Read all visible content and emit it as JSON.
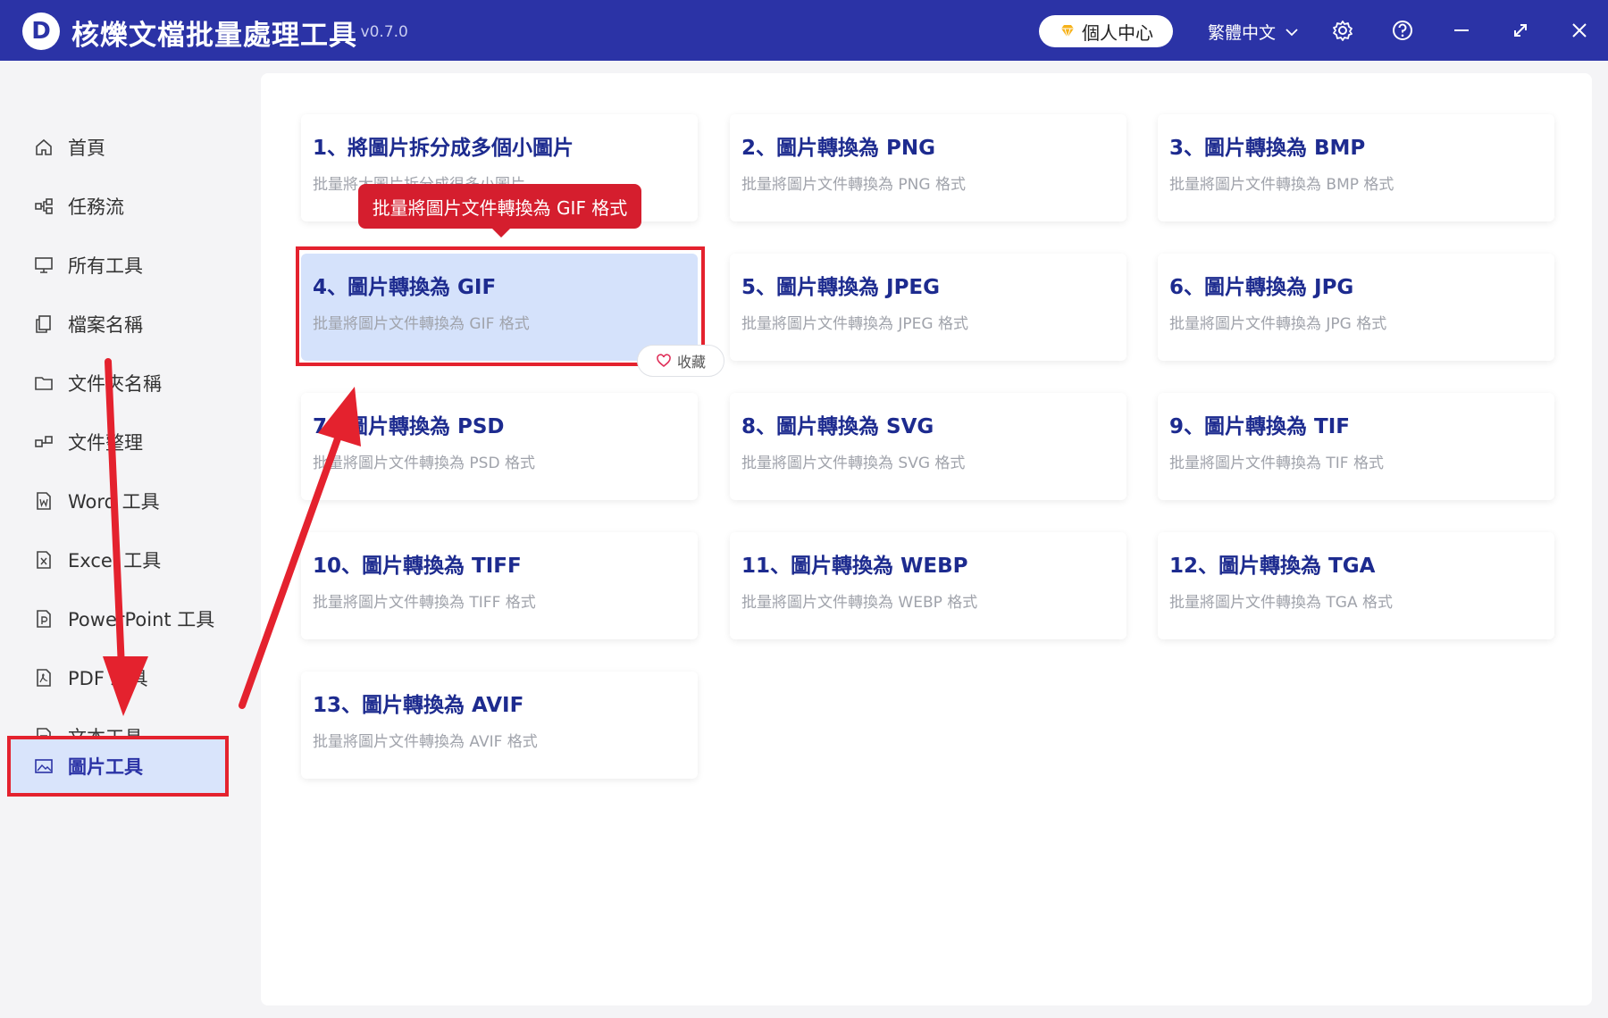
{
  "titlebar": {
    "logo": "D",
    "title": "核爍文檔批量處理工具",
    "version": "- v0.7.0",
    "personal_center": "個人中心",
    "language": "繁體中文",
    "icons": [
      "gear-icon",
      "help-icon",
      "minimize-icon",
      "maximize-icon",
      "close-icon"
    ]
  },
  "sidebar": {
    "items": [
      {
        "label": "首頁",
        "icon": "home-icon"
      },
      {
        "label": "任務流",
        "icon": "workflow-icon"
      },
      {
        "label": "所有工具",
        "icon": "monitor-icon"
      },
      {
        "label": "檔案名稱",
        "icon": "file-copy-icon"
      },
      {
        "label": "文件夾名稱",
        "icon": "folder-icon"
      },
      {
        "label": "文件整理",
        "icon": "organize-icon"
      },
      {
        "label": "Word 工具",
        "icon": "word-icon"
      },
      {
        "label": "Excel 工具",
        "icon": "excel-icon"
      },
      {
        "label": "PowerPoint 工具",
        "icon": "powerpoint-icon"
      },
      {
        "label": "PDF 工具",
        "icon": "pdf-icon"
      },
      {
        "label": "文本工具",
        "icon": "text-icon"
      },
      {
        "label": "圖片工具",
        "icon": "image-icon",
        "active": true
      }
    ]
  },
  "tools": [
    {
      "title": "1、將圖片拆分成多個小圖片",
      "desc": "批量將大圖片拆分成很多小圖片"
    },
    {
      "title": "2、圖片轉換為 PNG",
      "desc": "批量將圖片文件轉換為 PNG 格式"
    },
    {
      "title": "3、圖片轉換為 BMP",
      "desc": "批量將圖片文件轉換為 BMP 格式"
    },
    {
      "title": "4、圖片轉換為 GIF",
      "desc": "批量將圖片文件轉換為 GIF 格式",
      "highlighted": true
    },
    {
      "title": "5、圖片轉換為 JPEG",
      "desc": "批量將圖片文件轉換為 JPEG 格式"
    },
    {
      "title": "6、圖片轉換為 JPG",
      "desc": "批量將圖片文件轉換為 JPG 格式"
    },
    {
      "title": "7、圖片轉換為 PSD",
      "desc": "批量將圖片文件轉換為 PSD 格式"
    },
    {
      "title": "8、圖片轉換為 SVG",
      "desc": "批量將圖片文件轉換為 SVG 格式"
    },
    {
      "title": "9、圖片轉換為 TIF",
      "desc": "批量將圖片文件轉換為 TIF 格式"
    },
    {
      "title": "10、圖片轉換為 TIFF",
      "desc": "批量將圖片文件轉換為 TIFF 格式"
    },
    {
      "title": "11、圖片轉換為 WEBP",
      "desc": "批量將圖片文件轉換為 WEBP 格式"
    },
    {
      "title": "12、圖片轉換為 TGA",
      "desc": "批量將圖片文件轉換為 TGA 格式"
    },
    {
      "title": "13、圖片轉換為 AVIF",
      "desc": "批量將圖片文件轉換為 AVIF 格式"
    }
  ],
  "tooltip": "批量將圖片文件轉換為 GIF 格式",
  "favorite_label": "收藏",
  "annotation_color": "#e4222e"
}
